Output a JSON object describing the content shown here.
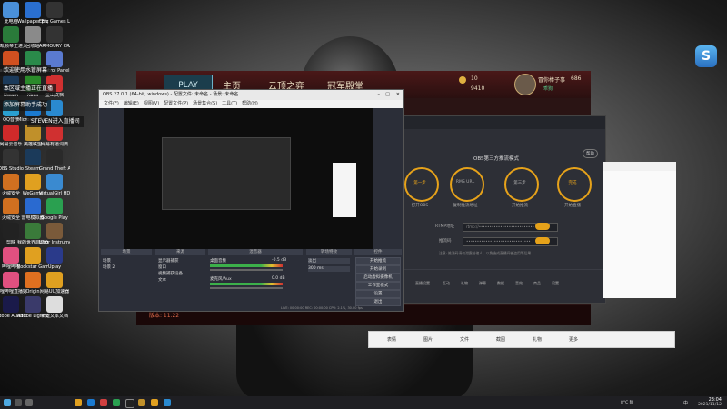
{
  "desktop": {
    "icons": [
      {
        "label": "此电脑",
        "color": "#4a90d9"
      },
      {
        "label": "Wallpaper Engine...",
        "color": "#2a6fd0"
      },
      {
        "label": "Epic Games Launcher",
        "color": "#333333"
      },
      {
        "label": "博毗领帝王进入",
        "color": "#2a7a3a"
      },
      {
        "label": "回收站",
        "color": "#8a8a8a"
      },
      {
        "label": "ARMOURY CRATE",
        "color": "#333333"
      },
      {
        "label": "Wallpaper Engine",
        "color": "#d05020"
      },
      {
        "label": "VS",
        "color": "#2a8a4a"
      },
      {
        "label": "Control Panel",
        "color": "#5a7ad0"
      },
      {
        "label": "Steam",
        "color": "#1b3a5a"
      },
      {
        "label": "Xbox",
        "color": "#2a8a2a"
      },
      {
        "label": "金山文档",
        "color": "#d03030"
      },
      {
        "label": "QQ音乐",
        "color": "#2aa0d0"
      },
      {
        "label": "Microsoft Edge",
        "color": "#1b7ad0"
      },
      {
        "label": "QQ",
        "color": "#2a8ad0"
      },
      {
        "label": "网易云音乐",
        "color": "#d02a2a"
      },
      {
        "label": "英雄联盟",
        "color": "#c0902a"
      },
      {
        "label": "网易有道词典",
        "color": "#d03030"
      },
      {
        "label": "OBS Studio",
        "color": "#333333"
      },
      {
        "label": "Steam",
        "color": "#1b3a5a"
      },
      {
        "label": "Grand Theft Auto V",
        "color": "#2a2a2a"
      },
      {
        "label": "火绒安全",
        "color": "#d07020"
      },
      {
        "label": "WeGame",
        "color": "#e0a020"
      },
      {
        "label": "VirtualGirl HD",
        "color": "#3a8ad0"
      },
      {
        "label": "火绒安全",
        "color": "#d07020"
      },
      {
        "label": "雷电模拟器",
        "color": "#2a6ad0"
      },
      {
        "label": "Google Play",
        "color": "#2aa050"
      },
      {
        "label": "剪映",
        "color": "#222222"
      },
      {
        "label": "我的世界启动器",
        "color": "#3a7a3a"
      },
      {
        "label": "Ugur Instruments",
        "color": "#7a5a3a"
      },
      {
        "label": "哔哩哔哩",
        "color": "#e05080"
      },
      {
        "label": "Rockstar Games",
        "color": "#e0a020"
      },
      {
        "label": "Uplay",
        "color": "#2a3a8a"
      },
      {
        "label": "哔哩哔哩直播姬",
        "color": "#e05080"
      },
      {
        "label": "Origin",
        "color": "#e07020"
      },
      {
        "label": "网易UU加速器",
        "color": "#e0a020"
      },
      {
        "label": "Adobe Audition",
        "color": "#1a1a4a"
      },
      {
        "label": "Adobe Lightroom",
        "color": "#3a3a6a"
      },
      {
        "label": "新建文本文档",
        "color": "#dddddd"
      }
    ],
    "notifications": [
      "欢迎使用水管屏幕",
      "本区域主播正在直播",
      "添加屏幕助手成功",
      "STEVEN进入直播间"
    ],
    "top_right_logo": "S"
  },
  "game_client": {
    "play_label": "PLAY",
    "tabs": [
      "主页",
      "云顶之弈",
      "冠军殿堂"
    ],
    "blue_essence": "10",
    "riot_points": "9410",
    "username": "冒你棒子事",
    "user_tag": "乖狗",
    "level": "686",
    "footer_label": "版本: 11.22"
  },
  "obs": {
    "title": "OBS 27.0.1 (64-bit, windows) - 配置文件: 未命名 - 场景: 未命名",
    "menu": [
      "文件(F)",
      "编辑(E)",
      "视图(V)",
      "配置文件(P)",
      "场景集合(S)",
      "工具(T)",
      "帮助(H)"
    ],
    "panels": [
      "场景",
      "来源",
      "混音器",
      "转场特效",
      "控件"
    ],
    "scene": "场景",
    "scene_2": "场景 2",
    "sources": [
      "显示器捕获",
      "窗口",
      "视频捕获设备",
      "文本"
    ],
    "mixer_channels": [
      "桌面音频",
      "麦克风/Aux"
    ],
    "mixer_level_a": "-0.5 dB",
    "mixer_level_b": "0.0 dB",
    "transition": "淡出",
    "duration": "300 ms",
    "controls": [
      "开始推流",
      "开始录制",
      "启动虚拟摄像机",
      "工作室模式",
      "设置",
      "退出"
    ],
    "status": "LIVE: 00:00:00  REC: 00:00:00  CPU: 2.1%, 30.00 fps"
  },
  "stream_tool": {
    "header": "OBS第三方推流模式",
    "help_label": "帮助",
    "steps": [
      {
        "title": "第一步",
        "desc": "打开OBS"
      },
      {
        "title": "RMS URL",
        "desc": "复制推流地址"
      },
      {
        "title": "第三步",
        "desc": "开始推流"
      },
      {
        "title": "完成",
        "desc": "开始直播"
      }
    ],
    "rtmp_label": "RTMP地址",
    "rtmp_value": "rtmp://••••••••••••••••••••••••••",
    "key_label": "推流码",
    "key_value": "••••••••••••••••••••••••••••••",
    "hint": "注意: 推流码请勿泄露给他人，以免造成直播间被盗用等后果",
    "bottom_tabs": [
      "直播设置",
      "互动",
      "礼物",
      "弹幕",
      "数据",
      "音效",
      "商品",
      "设置"
    ]
  },
  "chat_bar": {
    "items": [
      "表情",
      "图片",
      "文件",
      "截图",
      "礼物",
      "更多"
    ]
  },
  "taskbar": {
    "weather": "8°C 晴",
    "time": "23:04",
    "date": "2021/11/12",
    "lang": "中"
  },
  "colors": {
    "accent": "#e6a21a",
    "obs_bg": "#2b2e38",
    "game_red": "#4a1818"
  }
}
